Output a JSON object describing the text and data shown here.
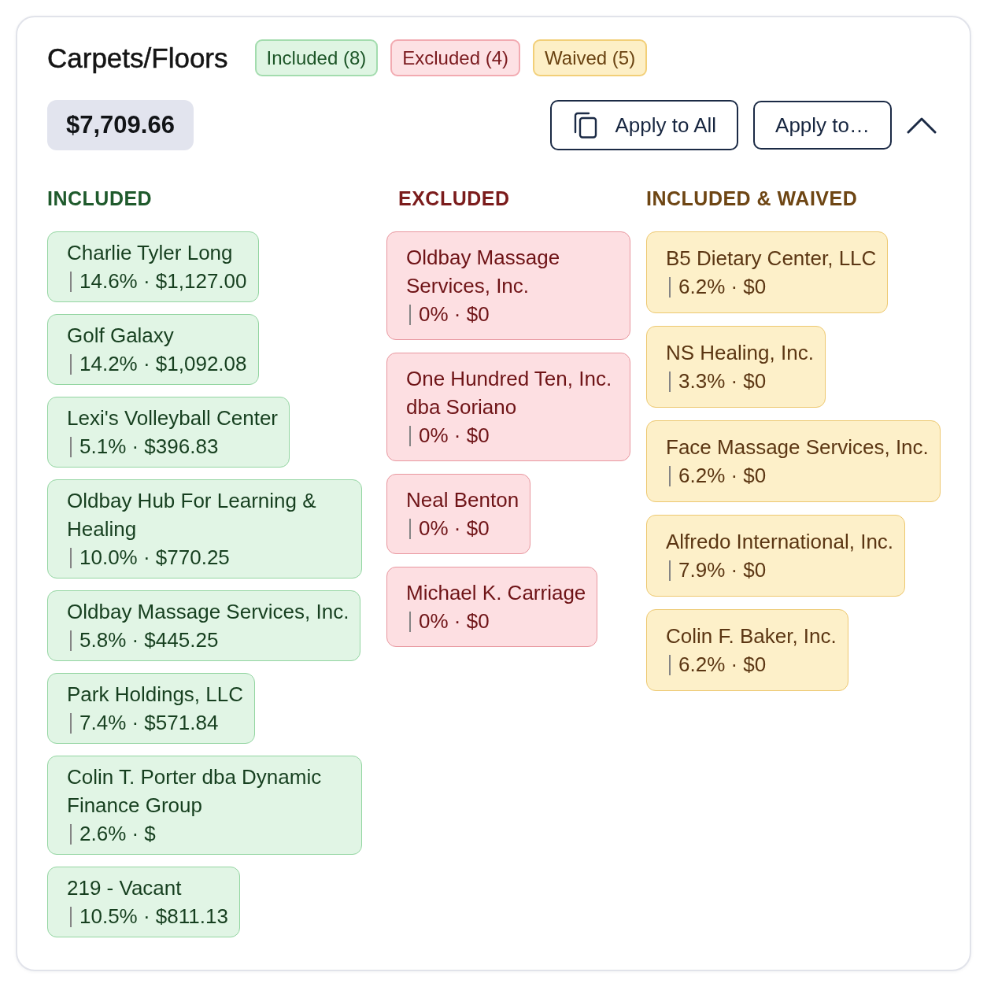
{
  "header": {
    "title": "Carpets/Floors",
    "badges": [
      {
        "label": "Included (8)",
        "kind": "included"
      },
      {
        "label": "Excluded (4)",
        "kind": "excluded"
      },
      {
        "label": "Waived (5)",
        "kind": "waived"
      }
    ]
  },
  "summary": {
    "total": "$7,709.66"
  },
  "actions": [
    {
      "label": "Apply to All",
      "kind": "with_icon"
    },
    {
      "label": "Apply to…",
      "kind": "plain"
    }
  ],
  "panel": {
    "expanded": true
  },
  "columns": [
    {
      "heading": "INCLUDED",
      "kind": "included",
      "items": [
        {
          "name": "Charlie Tyler Long",
          "detail": "14.6% · $1,127.00"
        },
        {
          "name": "Golf Galaxy",
          "detail": "14.2% · $1,092.08"
        },
        {
          "name": "Lexi's Volleyball Center",
          "detail": "5.1% · $396.83"
        },
        {
          "name": "Oldbay Hub For Learning & Healing",
          "detail": "10.0% · $770.25"
        },
        {
          "name": "Oldbay Massage Services, Inc.",
          "detail": "5.8% · $445.25"
        },
        {
          "name": "Park Holdings, LLC",
          "detail": "7.4% · $571.84"
        },
        {
          "name": "Colin T. Porter dba Dynamic Finance Group",
          "detail": "2.6% · $"
        },
        {
          "name": "219 - Vacant",
          "detail": "10.5% · $811.13"
        }
      ]
    },
    {
      "heading": "EXCLUDED",
      "kind": "excluded",
      "items": [
        {
          "name": "Oldbay Massage Services, Inc.",
          "detail": "0% · $0"
        },
        {
          "name": "One Hundred Ten, Inc. dba Soriano",
          "detail": "0% · $0"
        },
        {
          "name": "Neal Benton",
          "detail": "0% · $0"
        },
        {
          "name": "Michael K. Carriage",
          "detail": "0% · $0"
        }
      ]
    },
    {
      "heading": "INCLUDED & WAIVED",
      "kind": "waived",
      "items": [
        {
          "name": "B5 Dietary Center, LLC",
          "detail": "6.2% · $0"
        },
        {
          "name": "NS Healing, Inc.",
          "detail": "3.3% · $0"
        },
        {
          "name": "Face Massage Services, Inc.",
          "detail": "6.2% · $0"
        },
        {
          "name": "Alfredo International, Inc.",
          "detail": "7.9% · $0"
        },
        {
          "name": "Colin F. Baker, Inc.",
          "detail": "6.2% · $0"
        }
      ]
    }
  ]
}
